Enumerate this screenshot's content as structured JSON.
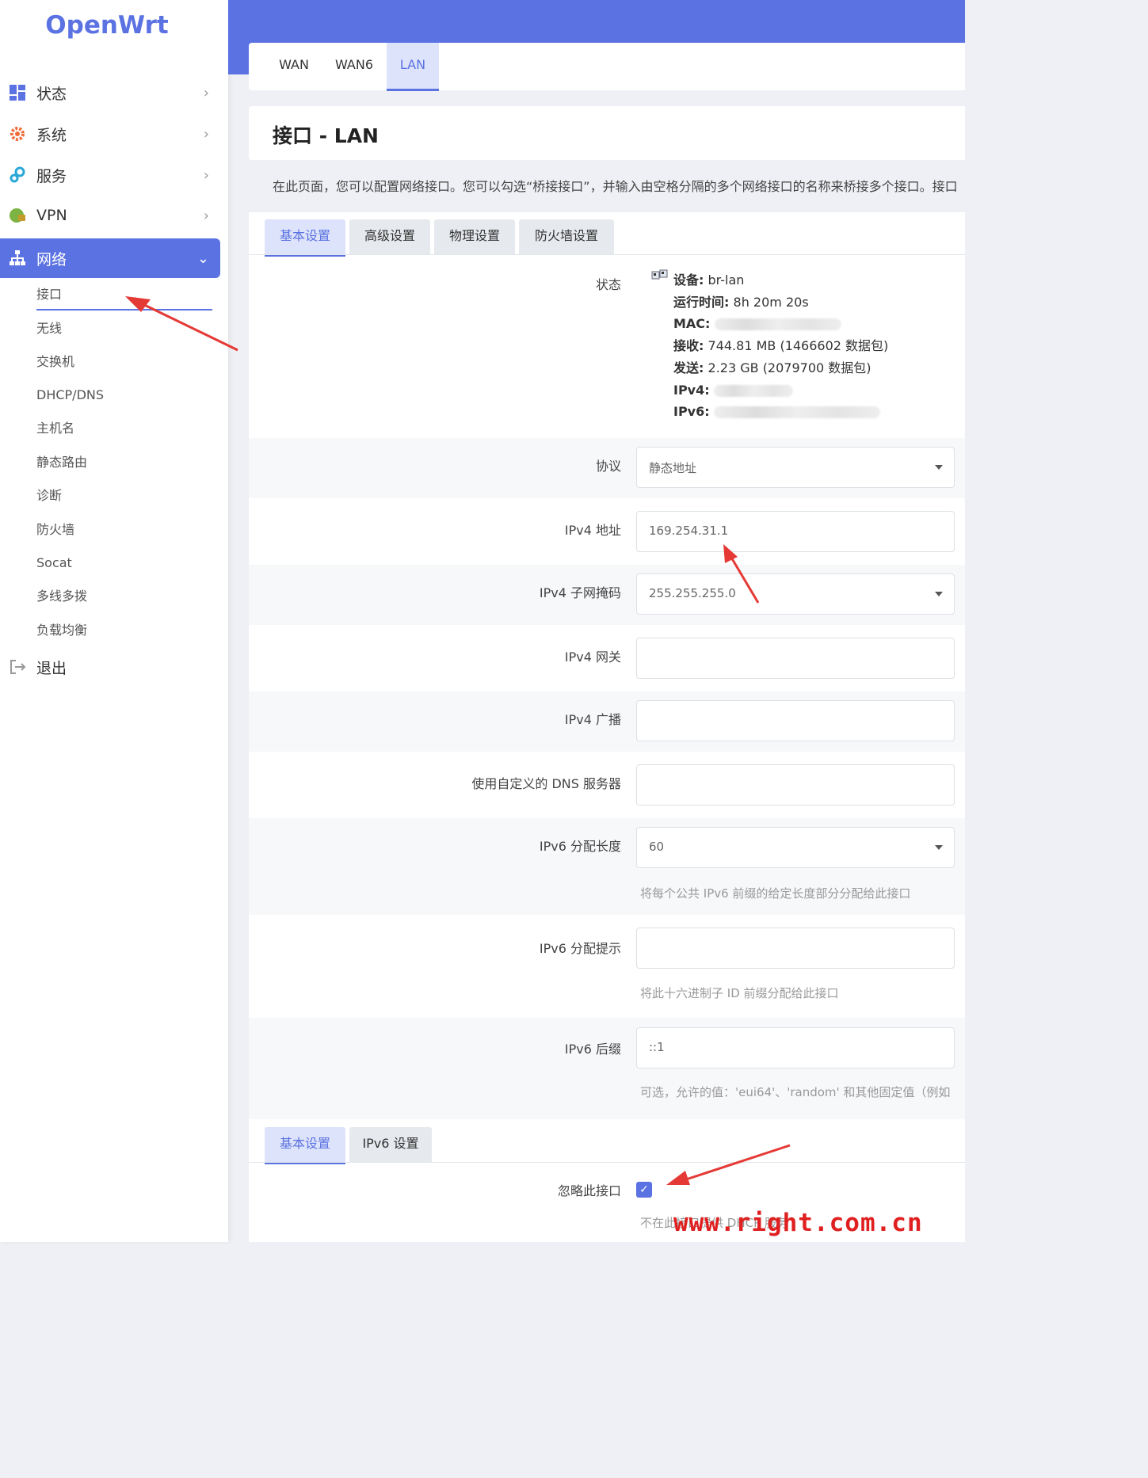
{
  "app": {
    "logo": "OpenWrt"
  },
  "sidebar": {
    "items": [
      {
        "label": "状态",
        "icon": "dashboard-icon"
      },
      {
        "label": "系统",
        "icon": "gear-icon"
      },
      {
        "label": "服务",
        "icon": "services-icon"
      },
      {
        "label": "VPN",
        "icon": "globe-lock-icon"
      },
      {
        "label": "网络",
        "icon": "network-icon"
      }
    ],
    "network_sub": [
      "接口",
      "无线",
      "交换机",
      "DHCP/DNS",
      "主机名",
      "静态路由",
      "诊断",
      "防火墙",
      "Socat",
      "多线多拨",
      "负载均衡"
    ],
    "logout": "退出"
  },
  "top_tabs": [
    "WAN",
    "WAN6",
    "LAN"
  ],
  "page": {
    "title": "接口 - LAN",
    "description": "在此页面，您可以配置网络接口。您可以勾选“桥接接口”，并输入由空格分隔的多个网络接口的名称来桥接多个接口。接口"
  },
  "section_tabs": [
    "基本设置",
    "高级设置",
    "物理设置",
    "防火墙设置"
  ],
  "status": {
    "label": "状态",
    "device_key": "设备",
    "device_val": "br-lan",
    "uptime_key": "运行时间",
    "uptime_val": "8h 20m 20s",
    "mac_key": "MAC",
    "rx_key": "接收",
    "rx_val": "744.81 MB (1466602 数据包)",
    "tx_key": "发送",
    "tx_val": "2.23 GB (2079700 数据包)",
    "ipv4_key": "IPv4",
    "ipv6_key": "IPv6"
  },
  "form": {
    "protocol": {
      "label": "协议",
      "value": "静态地址"
    },
    "ipv4_addr": {
      "label": "IPv4 地址",
      "value": "169.254.31.1"
    },
    "ipv4_mask": {
      "label": "IPv4 子网掩码",
      "value": "255.255.255.0"
    },
    "ipv4_gw": {
      "label": "IPv4 网关",
      "value": ""
    },
    "ipv4_bcast": {
      "label": "IPv4 广播",
      "value": ""
    },
    "dns": {
      "label": "使用自定义的 DNS 服务器",
      "value": ""
    },
    "ipv6_len": {
      "label": "IPv6 分配长度",
      "value": "60",
      "hint": "将每个公共 IPv6 前缀的给定长度部分分配给此接口"
    },
    "ipv6_hint": {
      "label": "IPv6 分配提示",
      "value": "",
      "hint": "将此十六进制子 ID 前缀分配给此接口"
    },
    "ipv6_suffix": {
      "label": "IPv6 后缀",
      "value": "::1",
      "hint": "可选，允许的值：'eui64'、'random' 和其他固定值（例如"
    }
  },
  "dhcp_tabs": [
    "基本设置",
    "IPv6 设置"
  ],
  "dhcp": {
    "ignore_label": "忽略此接口",
    "ignore_checked": true,
    "hint": "不在此接口提供 DHCP 服务"
  },
  "watermark": "www.right.com.cn",
  "colors": {
    "accent": "#5b72e2",
    "arrow": "#e53935"
  }
}
